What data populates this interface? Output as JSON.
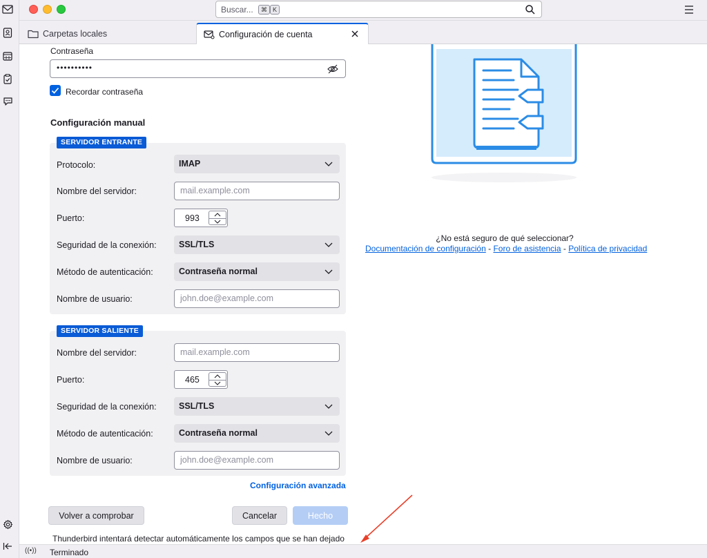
{
  "search": {
    "placeholder": "Buscar...",
    "shortcut_mod": "⌘",
    "shortcut_key": "K"
  },
  "tabs": [
    {
      "label": "Carpetas locales"
    },
    {
      "label": "Configuración de cuenta"
    }
  ],
  "form": {
    "password_label": "Contraseña",
    "password_value": "••••••••••",
    "remember_label": "Recordar contraseña",
    "remember_checked": true,
    "manual_title": "Configuración manual",
    "incoming": {
      "badge": "SERVIDOR ENTRANTE",
      "protocol_label": "Protocolo:",
      "protocol_value": "IMAP",
      "server_label": "Nombre del servidor:",
      "server_placeholder": "mail.example.com",
      "port_label": "Puerto:",
      "port_value": "993",
      "security_label": "Seguridad de la conexión:",
      "security_value": "SSL/TLS",
      "auth_label": "Método de autenticación:",
      "auth_value": "Contraseña normal",
      "user_label": "Nombre de usuario:",
      "user_placeholder": "john.doe@example.com"
    },
    "outgoing": {
      "badge": "SERVIDOR SALIENTE",
      "server_label": "Nombre del servidor:",
      "server_placeholder": "mail.example.com",
      "port_label": "Puerto:",
      "port_value": "465",
      "security_label": "Seguridad de la conexión:",
      "security_value": "SSL/TLS",
      "auth_label": "Método de autenticación:",
      "auth_value": "Contraseña normal",
      "user_label": "Nombre de usuario:",
      "user_placeholder": "john.doe@example.com"
    },
    "advanced_link": "Configuración avanzada",
    "recheck_button": "Volver a comprobar",
    "cancel_button": "Cancelar",
    "done_button": "Hecho",
    "info_text": "Thunderbird intentará detectar automáticamente los campos que se han dejado"
  },
  "help": {
    "question": "¿No está seguro de qué seleccionar?",
    "link_docs": "Documentación de configuración",
    "link_forum": "Foro de asistencia",
    "link_privacy": "Política de privacidad",
    "separator": " - "
  },
  "status": {
    "icon": "((•))",
    "text": "Terminado"
  },
  "colors": {
    "accent": "#0061e0",
    "badge": "#0a5bd6",
    "done_disabled": "#b4cdf5",
    "arrow": "#e8402a"
  }
}
